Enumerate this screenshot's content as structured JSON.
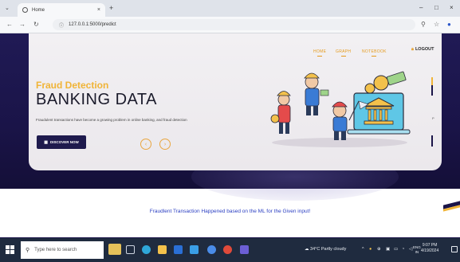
{
  "browser": {
    "tab_title": "Home",
    "tab_close": "×",
    "new_tab": "+",
    "url": "127.0.0.1:5000/predict",
    "window_controls": [
      "–",
      "□",
      "×"
    ]
  },
  "nav": {
    "items": [
      "HOME",
      "GRAPH",
      "NOTEBOOK"
    ],
    "logout": "LOGOUT"
  },
  "hero": {
    "subtitle": "Fraud Detection",
    "title": "BANKING DATA",
    "description": "Fraudulent transactions have become a growing problem in online banking, and fraud detection",
    "button_label": "DISCOVER NOW",
    "prev_arrow": "‹",
    "next_arrow": "›",
    "side_letter": "P"
  },
  "result": {
    "message": "Fraudlent Transaction Happened based on the ML for the Given input!"
  },
  "taskbar": {
    "search_placeholder": "Type here to search",
    "weather": "34°C  Partly cloudy",
    "language": "ENG\nIN",
    "time": "9:07 PM",
    "date": "4/19/2024"
  },
  "colors": {
    "brand_dark": "#1a1448",
    "accent_gold": "#f0b437",
    "message_blue": "#2b3fc2"
  }
}
